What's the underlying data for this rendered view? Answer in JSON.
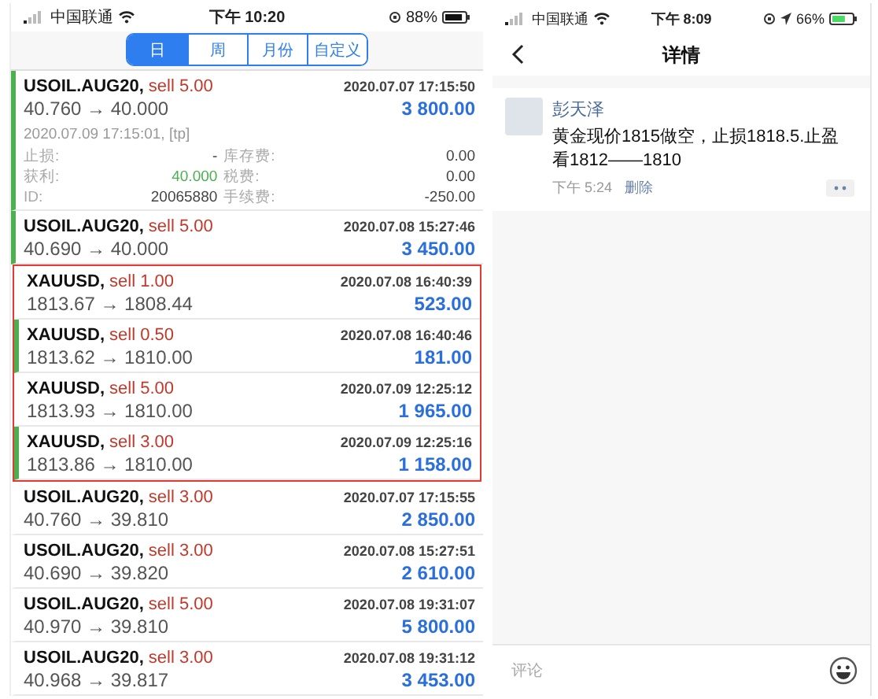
{
  "left_phone": {
    "status_bar": {
      "carrier": "中国联通",
      "time": "下午 10:20",
      "battery": "88%"
    },
    "period_tabs": [
      {
        "label": "日",
        "selected": true
      },
      {
        "label": "周",
        "selected": false
      },
      {
        "label": "月份",
        "selected": false
      },
      {
        "label": "自定义",
        "selected": false
      }
    ],
    "trades": [
      {
        "kind": "expanded",
        "flagged": true,
        "highlight": false,
        "symbol": "USOIL.AUG20,",
        "side": "sell 5.00",
        "time": "2020.07.07 17:15:50",
        "prices": "40.760 → 40.000",
        "profit": "3 800.00",
        "close_time": "2020.07.09 17:15:01, [tp]",
        "details": [
          {
            "label": "止损:",
            "value": "-",
            "label_2": "库存费:",
            "value_2": "0.00"
          },
          {
            "label": "获利:",
            "value": "40.000",
            "label_2": "税费:",
            "value_2": "0.00"
          },
          {
            "label": "ID:",
            "value": "20065880",
            "label_2": "手续费:",
            "value_2": "-250.00"
          }
        ]
      },
      {
        "kind": "row",
        "flagged": true,
        "highlight": false,
        "symbol": "USOIL.AUG20,",
        "side": "sell 5.00",
        "time": "2020.07.08 15:27:46",
        "prices": "40.690 → 40.000",
        "profit": "3 450.00"
      },
      {
        "kind": "row",
        "flagged": false,
        "highlight": true,
        "symbol": "XAUUSD,",
        "side": "sell 1.00",
        "time": "2020.07.08 16:40:39",
        "prices": "1813.67 → 1808.44",
        "profit": "523.00"
      },
      {
        "kind": "row",
        "flagged": true,
        "highlight": true,
        "symbol": "XAUUSD,",
        "side": "sell 0.50",
        "time": "2020.07.08 16:40:46",
        "prices": "1813.62 → 1810.00",
        "profit": "181.00"
      },
      {
        "kind": "row",
        "flagged": false,
        "highlight": true,
        "symbol": "XAUUSD,",
        "side": "sell 5.00",
        "time": "2020.07.09 12:25:12",
        "prices": "1813.93 → 1810.00",
        "profit": "1 965.00"
      },
      {
        "kind": "row",
        "flagged": true,
        "highlight": true,
        "symbol": "XAUUSD,",
        "side": "sell 3.00",
        "time": "2020.07.09 12:25:16",
        "prices": "1813.86 → 1810.00",
        "profit": "1 158.00"
      },
      {
        "kind": "row",
        "flagged": false,
        "highlight": false,
        "symbol": "USOIL.AUG20,",
        "side": "sell 3.00",
        "time": "2020.07.07 17:15:55",
        "prices": "40.760 → 39.810",
        "profit": "2 850.00"
      },
      {
        "kind": "row",
        "flagged": false,
        "highlight": false,
        "symbol": "USOIL.AUG20,",
        "side": "sell 3.00",
        "time": "2020.07.08 15:27:51",
        "prices": "40.690 → 39.820",
        "profit": "2 610.00"
      },
      {
        "kind": "row",
        "flagged": false,
        "highlight": false,
        "symbol": "USOIL.AUG20,",
        "side": "sell 5.00",
        "time": "2020.07.08 19:31:07",
        "prices": "40.970 → 39.810",
        "profit": "5 800.00"
      },
      {
        "kind": "row",
        "flagged": false,
        "highlight": false,
        "symbol": "USOIL.AUG20,",
        "side": "sell 3.00",
        "time": "2020.07.08 19:31:12",
        "prices": "40.968 → 39.817",
        "profit": "3 453.00"
      }
    ]
  },
  "right_phone": {
    "status_bar": {
      "carrier": "中国联通",
      "time": "下午 8:09",
      "battery": "66%"
    },
    "nav": {
      "title": "详情"
    },
    "post": {
      "author": "彭天泽",
      "text": "黄金现价1815做空，止损1818.5.止盈看1812——1810",
      "time": "下午 5:24",
      "delete": "删除"
    },
    "comment": {
      "placeholder": "评论"
    }
  }
}
